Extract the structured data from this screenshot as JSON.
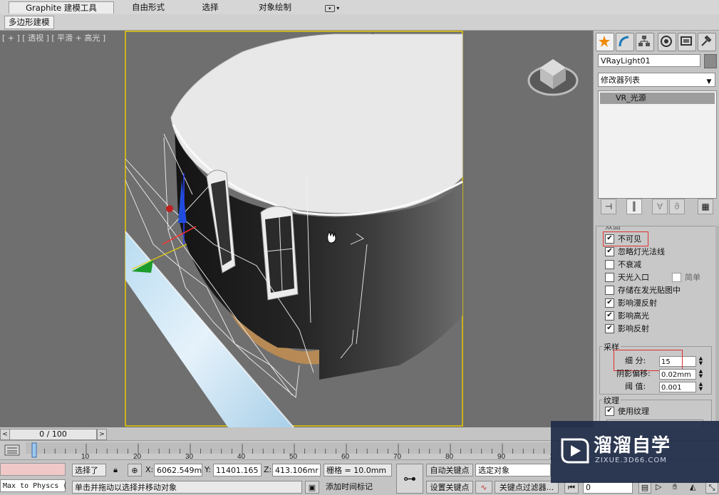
{
  "ribbon": {
    "tabs": [
      {
        "label": "Graphite 建模工具",
        "active": true
      },
      {
        "label": "自由形式",
        "active": false
      },
      {
        "label": "选择",
        "active": false
      },
      {
        "label": "对象绘制",
        "active": false
      }
    ],
    "subtab": "多边形建模"
  },
  "viewport": {
    "label": "[ + ] [ 透视 ] [ 平滑 + 高光 ]",
    "viewcube_icon": "viewcube-icon",
    "cursor_icon": "hand-cursor-icon"
  },
  "command_panel": {
    "tab_icons": [
      "create-icon",
      "modify-icon",
      "hierarchy-icon",
      "motion-icon",
      "display-icon",
      "utilities-icon"
    ],
    "object_name": "VRayLight01",
    "modifier_list": "修改器列表",
    "stack_item": "VR_光源",
    "options_partial": "双面",
    "options": [
      {
        "label": "不可见",
        "checked": true
      },
      {
        "label": "忽略灯光法线",
        "checked": true
      },
      {
        "label": "不衰减",
        "checked": false
      },
      {
        "label": "天光入口",
        "checked": false
      },
      {
        "label": "存储在发光贴图中",
        "checked": false
      },
      {
        "label": "影响漫反射",
        "checked": true
      },
      {
        "label": "影响高光",
        "checked": true
      },
      {
        "label": "影响反射",
        "checked": true
      }
    ],
    "simple_option": {
      "label": "简单",
      "checked": false
    },
    "sampling": {
      "title": "采样",
      "subdivs_label": "细  分:",
      "subdivs_value": "15",
      "shadow_bias_label": "阴影偏移:",
      "shadow_bias_value": "0.02mm",
      "threshold_label": "阈  值:",
      "threshold_value": "0.001"
    },
    "texture": {
      "title": "纹理",
      "use_texture_label": "使用纹理",
      "use_texture_checked": true
    }
  },
  "timeline": {
    "frame_display": "0 / 100",
    "ticks": [
      0,
      10,
      20,
      30,
      40,
      50,
      60,
      70,
      80,
      90,
      100
    ],
    "current_frame": 0
  },
  "status": {
    "maxscript_line": "Max to Physcs (",
    "selection": "选择了",
    "x_label": "X:",
    "x_value": "6062.549m",
    "y_label": "Y:",
    "y_value": "11401.165",
    "z_label": "Z:",
    "z_value": "413.106mr",
    "grid": "栅格 = 10.0mm",
    "prompt": "单击并拖动以选择并移动对象",
    "add_time_tag": "添加时间标记",
    "auto_key": "自动关键点",
    "set_key": "设置关键点",
    "selected_object": "选定对象",
    "key_filters": "关键点过滤器...",
    "frame_field": "0"
  },
  "watermark": {
    "title": "溜溜自学",
    "subtitle": "ZIXUE.3D66.COM"
  },
  "colors": {
    "viewport_bg": "#6f6f6f",
    "viewport_border": "#e8c800",
    "highlight_box": "#e03030",
    "light_icon_blue": "#1f4fd6",
    "light_icon_green": "#1c9c2a"
  }
}
